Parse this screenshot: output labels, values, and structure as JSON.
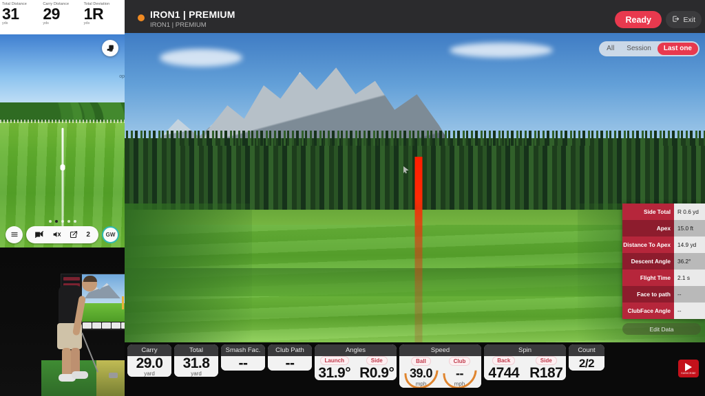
{
  "top_stats": [
    {
      "label": "Total Distance",
      "value": "31",
      "unit": "yds"
    },
    {
      "label": "Carry Distance",
      "value": "29",
      "unit": "yds"
    },
    {
      "label": "Total Deviation",
      "value": "1R",
      "unit": "yds"
    }
  ],
  "minimap": {
    "device_icon": "monitor-icon",
    "side_tag": "op",
    "dots": 5,
    "active_dot": 1,
    "toolbar": {
      "menu_icon": "hamburger-menu-icon",
      "camera_icon": "camera-off-icon",
      "mute_icon": "speaker-mute-icon",
      "share_icon": "share-external-icon",
      "count": "2",
      "club_badge": "GW"
    }
  },
  "header": {
    "status_dot_color": "#f08a22",
    "title": "IRON1 | PREMIUM",
    "subtitle": "IRON1 | PREMIUM",
    "ready_label": "Ready",
    "exit_label": "Exit",
    "exit_icon": "exit-logout-icon",
    "ready_color": "#e8394e"
  },
  "filters": {
    "options": [
      "All",
      "Session",
      "Last one"
    ],
    "active": "Last one",
    "active_color": "#e8394e"
  },
  "data_table": {
    "rows": [
      {
        "label": "Side Total",
        "value": "R 0.6 yd"
      },
      {
        "label": "Apex",
        "value": "15.0 ft"
      },
      {
        "label": "Distance To Apex",
        "value": "14.9 yd"
      },
      {
        "label": "Descent Angle",
        "value": "36.2°"
      },
      {
        "label": "Flight Time",
        "value": "2.1 s"
      },
      {
        "label": "Face to path",
        "value": "--"
      },
      {
        "label": "ClubFace Angle",
        "value": "--"
      }
    ],
    "edit_button": "Edit Data",
    "label_color": "#b6263b",
    "label_color_alt": "#8d1c2d"
  },
  "metrics": [
    {
      "kind": "single",
      "title": "Carry",
      "value": "29.0",
      "unit": "yard"
    },
    {
      "kind": "single",
      "title": "Total",
      "value": "31.8",
      "unit": "yard"
    },
    {
      "kind": "single",
      "title": "Smash Fac.",
      "value": "--",
      "unit": ""
    },
    {
      "kind": "single",
      "title": "Club Path",
      "value": "--",
      "unit": ""
    },
    {
      "kind": "duo",
      "title": "Angles",
      "cells": [
        {
          "tag": "Launch",
          "value": "31.9°"
        },
        {
          "tag": "Side",
          "value": "R0.9°"
        }
      ]
    },
    {
      "kind": "gauge",
      "title": "Speed",
      "cells": [
        {
          "tag": "Ball",
          "value": "39.0",
          "unit": "mph"
        },
        {
          "tag": "Club",
          "value": "--",
          "unit": "mph"
        }
      ]
    },
    {
      "kind": "duo",
      "title": "Spin",
      "cells": [
        {
          "tag": "Back",
          "value": "4744"
        },
        {
          "tag": "Side",
          "value": "R187"
        }
      ]
    },
    {
      "kind": "count",
      "title": "Count",
      "value": "2/2"
    }
  ],
  "subscribe": {
    "icon": "play-triangle-icon",
    "label": "SUBSCRIBE"
  }
}
